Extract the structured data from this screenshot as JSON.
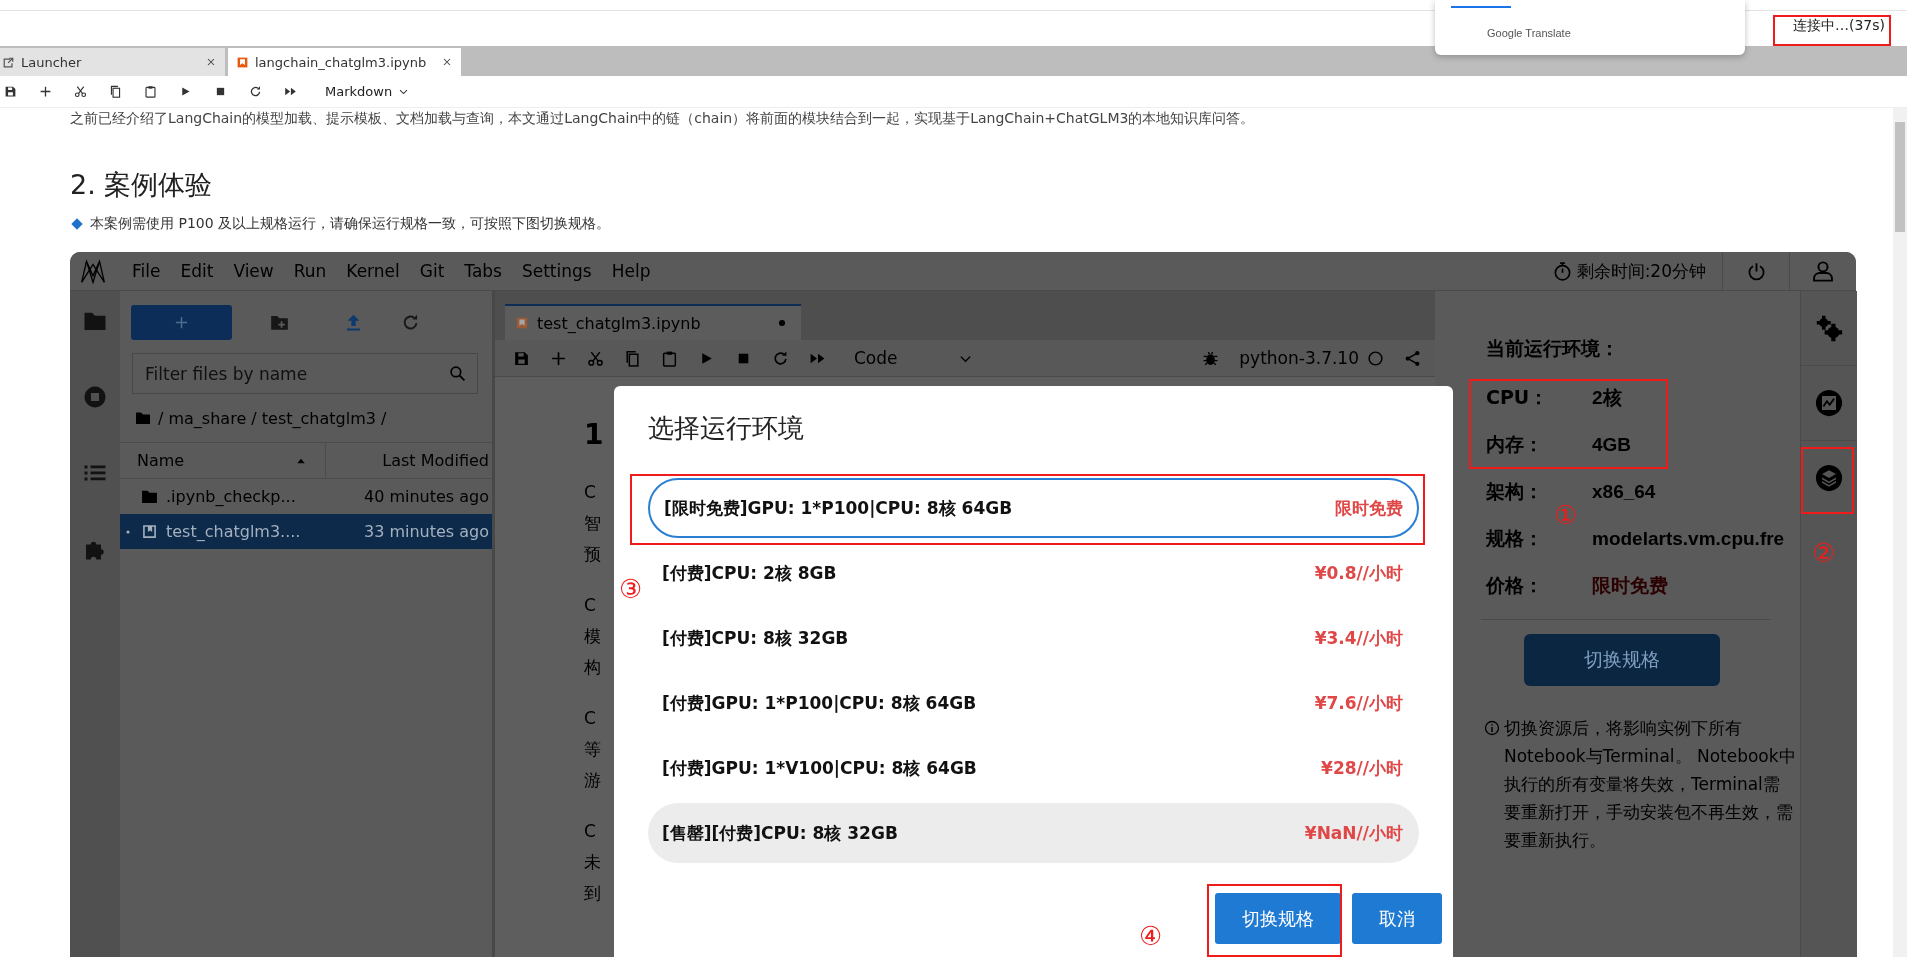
{
  "browser": {
    "translate_label": "Google Translate",
    "connection_status": "连接中…(37s)"
  },
  "tabs": [
    {
      "label": "Launcher",
      "kind": "launcher",
      "selected": false
    },
    {
      "label": "langchain_chatglm3.ipynb",
      "kind": "notebook",
      "selected": true
    }
  ],
  "toolbar": {
    "cell_type": "Markdown"
  },
  "document": {
    "intro": "之前已经介绍了LangChain的模型加载、提示模板、文档加载与查询，本文通过LangChain中的链（chain）将前面的模块结合到一起，实现基于LangChain+ChatGLM3的本地知识库问答。",
    "heading": "2. 案例体验",
    "note": "本案例需使用 P100 及以上规格运行，请确保运行规格一致，可按照下图切换规格。"
  },
  "embedded_screen": {
    "menu": [
      "File",
      "Edit",
      "View",
      "Run",
      "Kernel",
      "Git",
      "Tabs",
      "Settings",
      "Help"
    ],
    "remaining_time": "剩余时间:20分钟",
    "file_browser": {
      "filter_placeholder": "Filter files by name",
      "path": "/ ma_share / test_chatglm3 /",
      "columns": [
        "Name",
        "Last Modified"
      ],
      "rows": [
        {
          "name": ".ipynb_checkp...",
          "modified": "40 minutes ago",
          "kind": "folder",
          "running": false,
          "selected": false
        },
        {
          "name": "test_chatglm3....",
          "modified": "33 minutes ago",
          "kind": "notebook",
          "running": true,
          "selected": true
        }
      ]
    },
    "notebook_tab": "test_chatglm3.ipynb",
    "notebook_toolbar": {
      "cell_type": "Code",
      "kernel": "python-3.7.10"
    },
    "notebook_heading": "1",
    "notebook_fragments": [
      [
        "C",
        "智",
        "预"
      ],
      [
        "C",
        "模",
        "构"
      ],
      [
        "C",
        "等",
        "游"
      ],
      [
        "C",
        "未",
        "到"
      ]
    ],
    "environment": {
      "title": "当前运行环境：",
      "fields": [
        {
          "label": "CPU：",
          "value": "2核",
          "kind": "plain"
        },
        {
          "label": "内存：",
          "value": "4GB",
          "kind": "plain"
        },
        {
          "label": "架构：",
          "value": "x86_64",
          "kind": "plain"
        },
        {
          "label": "规格：",
          "value": "modelarts.vm.cpu.fre",
          "kind": "plain"
        },
        {
          "label": "价格：",
          "value": "限时免费",
          "kind": "price"
        }
      ],
      "button": "切换规格",
      "info": "切换资源后，将影响实例下所有Notebook与Terminal。 Notebook中执行的所有变量将失效，Terminal需要重新打开，手动安装包不再生效，需要重新执行。"
    },
    "dialog": {
      "title": "选择运行环境",
      "options": [
        {
          "name": "[限时免费]GPU: 1*P100|CPU: 8核 64GB",
          "price": "限时免费",
          "selected": true,
          "disabled": false
        },
        {
          "name": "[付费]CPU: 2核 8GB",
          "price": "¥0.8//小时",
          "selected": false,
          "disabled": false
        },
        {
          "name": "[付费]CPU: 8核 32GB",
          "price": "¥3.4//小时",
          "selected": false,
          "disabled": false
        },
        {
          "name": "[付费]GPU: 1*P100|CPU: 8核 64GB",
          "price": "¥7.6//小时",
          "selected": false,
          "disabled": false
        },
        {
          "name": "[付费]GPU: 1*V100|CPU: 8核 64GB",
          "price": "¥28//小时",
          "selected": false,
          "disabled": false
        },
        {
          "name": "[售罄][付费]CPU: 8核 32GB",
          "price": "¥NaN//小时",
          "selected": false,
          "disabled": true
        }
      ],
      "buttons": [
        {
          "label": "切换规格",
          "kind": "primary"
        },
        {
          "label": "取消",
          "kind": "secondary"
        }
      ]
    }
  },
  "annotations": [
    "①",
    "②",
    "③",
    "④"
  ]
}
